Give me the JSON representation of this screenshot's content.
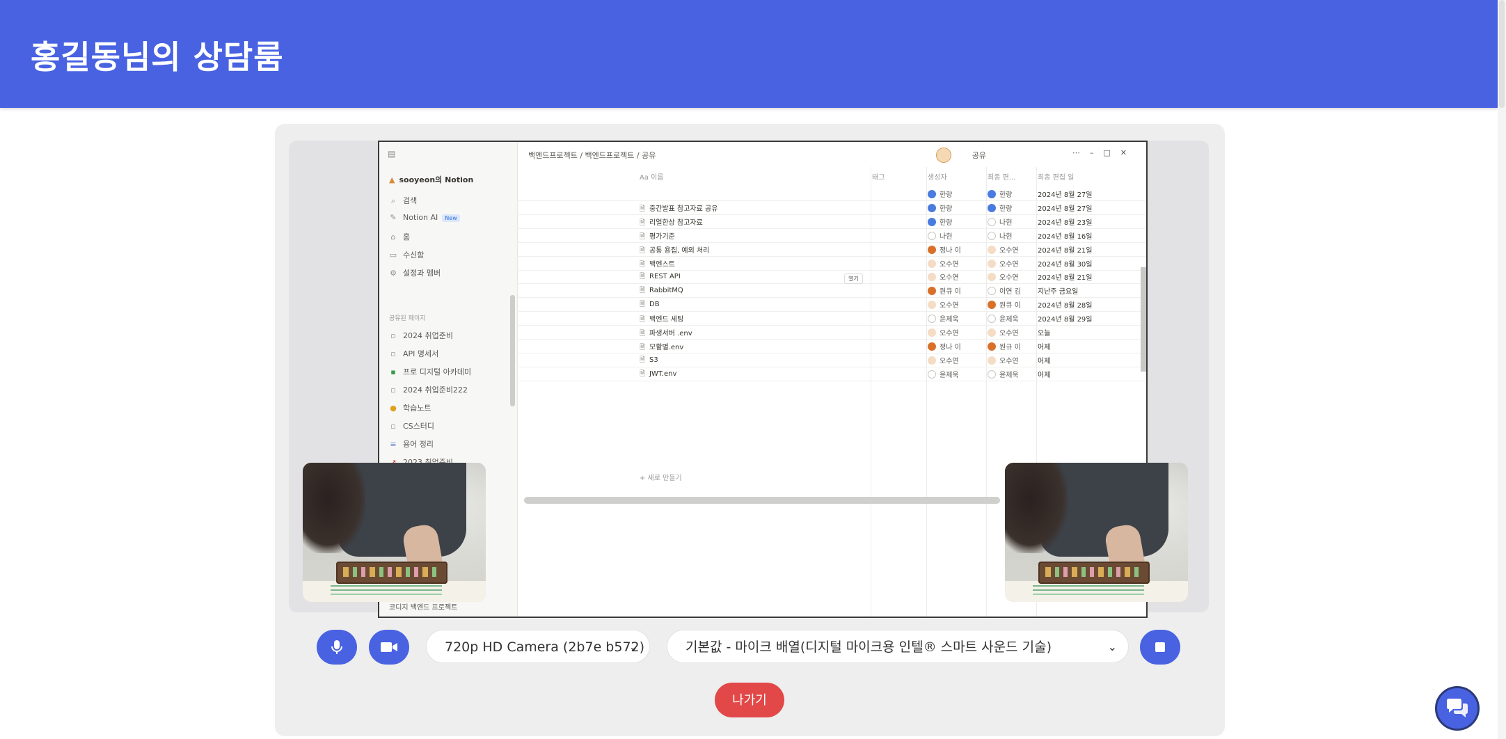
{
  "header": {
    "title": "홍길동님의 상담룸"
  },
  "shared_screen": {
    "sidebar": {
      "workspace": "sooyeon의 Notion",
      "items": [
        {
          "icon": "search-icon",
          "label": "검색"
        },
        {
          "icon": "notion-ai-icon",
          "label": "Notion AI",
          "badge": "New"
        },
        {
          "icon": "home-icon",
          "label": "홈"
        },
        {
          "icon": "inbox-icon",
          "label": "수신함"
        },
        {
          "icon": "gear-icon",
          "label": "설정과 멤버"
        }
      ],
      "section_label": "공유된 페이지",
      "pages": [
        "2024 취업준비",
        "API 명세서",
        "프로 디지털 아카데미",
        "2024 취업준비222",
        "학습노트",
        "CS스터디",
        "용어 정리",
        "2023 취업준비"
      ],
      "bottom_item": "코디지 백엔드 프로젝트"
    },
    "topbar": {
      "breadcrumb": "백엔드프로젝트 / 백엔드프로젝트 / 공유",
      "share": "공유"
    },
    "table": {
      "columns": [
        "Aa 이름",
        "태그",
        "생성자",
        "최종 편...",
        "최종 편집 일"
      ],
      "rows": [
        {
          "name": "",
          "creator": "한량",
          "creator_dot": "blue",
          "editor": "한량",
          "editor_dot": "blue",
          "date": "2024년 8월 27일"
        },
        {
          "name": "중간발표 참고자료 공유",
          "creator": "한량",
          "creator_dot": "blue",
          "editor": "한량",
          "editor_dot": "blue",
          "date": "2024년 8월 27일"
        },
        {
          "name": "리얼한상 참고자료",
          "creator": "한량",
          "creator_dot": "blue",
          "editor": "나현",
          "editor_dot": "",
          "date": "2024년 8월 23일"
        },
        {
          "name": "평가기준",
          "creator": "나현",
          "creator_dot": "",
          "editor": "나현",
          "editor_dot": "",
          "date": "2024년 8월 16일"
        },
        {
          "name": "공통 용집, 예외 처리",
          "creator": "정나 이",
          "creator_dot": "orange",
          "editor": "오수연",
          "editor_dot": "light",
          "date": "2024년 8월 21일"
        },
        {
          "name": "백엔스트",
          "creator": "오수연",
          "creator_dot": "light",
          "editor": "오수연",
          "editor_dot": "light",
          "date": "2024년 8월 30일"
        },
        {
          "name": "REST API",
          "creator": "오수연",
          "creator_dot": "light",
          "editor": "오수연",
          "editor_dot": "light",
          "date": "2024년 8월 21일",
          "chip": "열기"
        },
        {
          "name": "RabbitMQ",
          "creator": "원큐 이",
          "creator_dot": "orange",
          "editor": "이연 김",
          "editor_dot": "",
          "date": "지난주 금요일"
        },
        {
          "name": "DB",
          "creator": "오수연",
          "creator_dot": "light",
          "editor": "원큐 이",
          "editor_dot": "orange",
          "date": "2024년 8월 28일"
        },
        {
          "name": "백엔드 세팅",
          "creator": "윤제욱",
          "creator_dot": "",
          "editor": "윤제욱",
          "editor_dot": "",
          "date": "2024년 8월 29일"
        },
        {
          "name": "파생서버 .env",
          "creator": "오수연",
          "creator_dot": "light",
          "editor": "오수연",
          "editor_dot": "light",
          "date": "오늘"
        },
        {
          "name": "모활별.env",
          "creator": "정나 이",
          "creator_dot": "orange",
          "editor": "원규 이",
          "editor_dot": "orange",
          "date": "어제"
        },
        {
          "name": "S3",
          "creator": "오수연",
          "creator_dot": "light",
          "editor": "오수연",
          "editor_dot": "light",
          "date": "어제"
        },
        {
          "name": "JWT.env",
          "creator": "윤제욱",
          "creator_dot": "",
          "editor": "윤제욱",
          "editor_dot": "",
          "date": "어제"
        }
      ],
      "new_row": "+ 새로 만들기"
    }
  },
  "controls": {
    "camera_select": {
      "value": "720p HD Camera (2b7e b572)"
    },
    "mic_select": {
      "value": "기본값 - 마이크 배열(디지털 마이크용 인텔® 스마트 사운드 기술)"
    },
    "leave_label": "나가기"
  },
  "colors": {
    "primary": "#4862e2",
    "danger": "#e24848"
  }
}
